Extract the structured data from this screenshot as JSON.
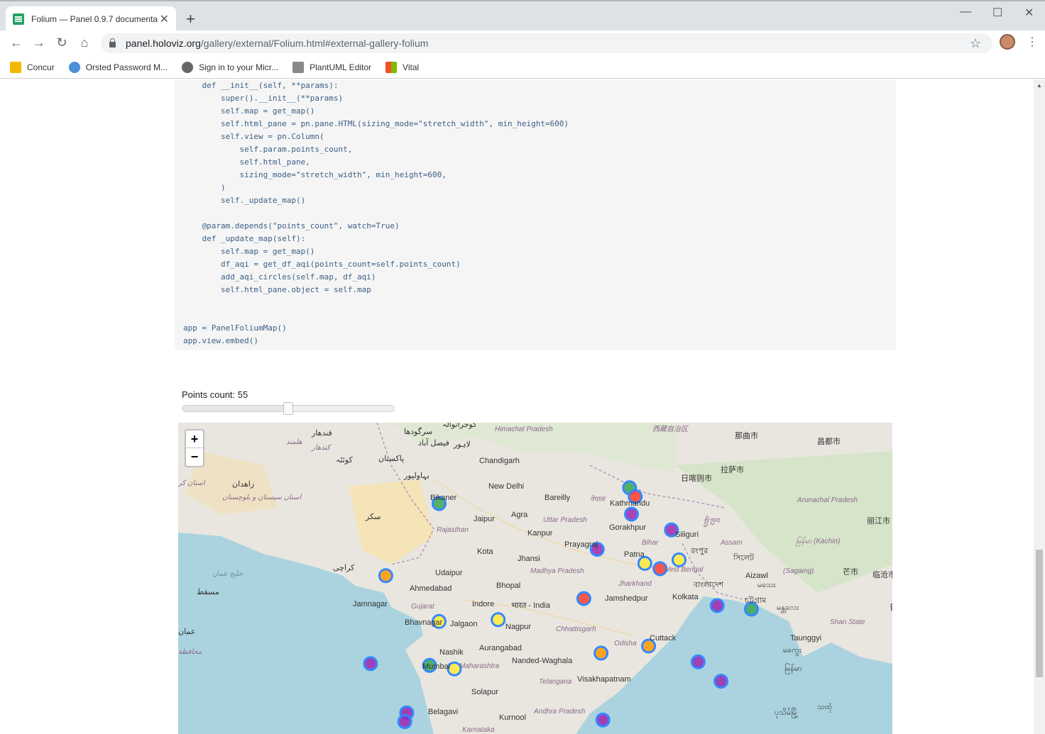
{
  "browser": {
    "tab_title": "Folium — Panel 0.9.7 documenta",
    "url_host": "panel.holoviz.org",
    "url_path": "/gallery/external/Folium.html#external-gallery-folium",
    "bookmarks": [
      "Concur",
      "Orsted Password M...",
      "Sign in to your Micr...",
      "PlantUML Editor",
      "Vital"
    ]
  },
  "code": {
    "lines": [
      "    def __init__(self, **params):",
      "        super().__init__(**params)",
      "        self.map = get_map()",
      "        self.html_pane = pn.pane.HTML(sizing_mode=\"stretch_width\", min_height=600)",
      "        self.view = pn.Column(",
      "            self.param.points_count,",
      "            self.html_pane,",
      "            sizing_mode=\"stretch_width\", min_height=600,",
      "        )",
      "        self._update_map()",
      "",
      "    @param.depends(\"points_count\", watch=True)",
      "    def _update_map(self):",
      "        self.map = get_map()",
      "        df_aqi = get_df_aqi(points_count=self.points_count)",
      "        add_aqi_circles(self.map, df_aqi)",
      "        self.html_pane.object = self.map",
      "",
      "",
      "app = PanelFoliumMap()",
      "app.view.embed()"
    ]
  },
  "slider": {
    "label": "Points count: ",
    "value": "55",
    "fraction": 0.5
  },
  "map": {
    "zoom_in": "+",
    "zoom_out": "−",
    "labels": [
      {
        "text": "قندهار"
      },
      {
        "text": "سرگودھا"
      },
      {
        "text": "گوجرانوالہ"
      },
      {
        "text": "Himachal Pradesh",
        "kind": "region"
      },
      {
        "text": "西藏自治区",
        "kind": "region"
      },
      {
        "text": "那曲市"
      },
      {
        "text": "昌都市"
      },
      {
        "text": "هلمند",
        "kind": "region"
      },
      {
        "text": "کندهار",
        "kind": "region"
      },
      {
        "text": "فیصل آباد"
      },
      {
        "text": "لاہور"
      },
      {
        "text": "کوئٹہ"
      },
      {
        "text": "پاکستان"
      },
      {
        "text": "Chandigarh"
      },
      {
        "text": "日喀则市"
      },
      {
        "text": "拉萨市"
      },
      {
        "text": "استان کر",
        "kind": "region"
      },
      {
        "text": "زاهدان"
      },
      {
        "text": "بہاولپور"
      },
      {
        "text": "New Delhi"
      },
      {
        "text": "नेपाल",
        "kind": "region"
      },
      {
        "text": "Bareilly"
      },
      {
        "text": "Bikaner"
      },
      {
        "text": "استان سیستان و بلوچستان",
        "kind": "region"
      },
      {
        "text": "Kathmandu"
      },
      {
        "text": "Arunachal Pradesh",
        "kind": "region"
      },
      {
        "text": "སྤྱི་ཁྱབ",
        "kind": "region"
      },
      {
        "text": "Agra"
      },
      {
        "text": "Jaipur"
      },
      {
        "text": "سکر"
      },
      {
        "text": "Uttar Pradesh",
        "kind": "region"
      },
      {
        "text": "Gorakhpur"
      },
      {
        "text": "丽江市"
      },
      {
        "text": "Rajasthan",
        "kind": "region"
      },
      {
        "text": "Kanpur"
      },
      {
        "text": "Siliguri"
      },
      {
        "text": "Prayagraj"
      },
      {
        "text": "Bihar",
        "kind": "region"
      },
      {
        "text": "Assam",
        "kind": "region"
      },
      {
        "text": "Kota"
      },
      {
        "text": "রংপুর"
      },
      {
        "text": "မြန်မာ (Kachin)",
        "kind": "region"
      },
      {
        "text": "Patna"
      },
      {
        "text": "সিলেট"
      },
      {
        "text": "Jhansi"
      },
      {
        "text": "کراچی"
      },
      {
        "text": "Udaipur"
      },
      {
        "text": "West Bengal",
        "kind": "region"
      },
      {
        "text": "(Sagaing)",
        "kind": "region"
      },
      {
        "text": "芒市"
      },
      {
        "text": "临沧市"
      },
      {
        "text": "Madhya Pradesh",
        "kind": "region"
      },
      {
        "text": "Aizawl"
      },
      {
        "text": "خليج عمان",
        "kind": "sea"
      },
      {
        "text": "Jharkhand",
        "kind": "region"
      },
      {
        "text": "မသေး"
      },
      {
        "text": "مسقط"
      },
      {
        "text": "Ahmedabad"
      },
      {
        "text": "Bhopal"
      },
      {
        "text": "বাংলাদেশ"
      },
      {
        "text": "Jamshedpur"
      },
      {
        "text": "Kolkata"
      },
      {
        "text": "চট্টগ্রাম"
      },
      {
        "text": "Jamnagar"
      },
      {
        "text": "Gujarat",
        "kind": "region"
      },
      {
        "text": "Indore"
      },
      {
        "text": "भारत - India"
      },
      {
        "text": "မန္တလေး"
      },
      {
        "text": "Shan State",
        "kind": "region"
      },
      {
        "text": "普洱"
      },
      {
        "text": "Bhavnagar"
      },
      {
        "text": "Jalgaon"
      },
      {
        "text": "Nagpur"
      },
      {
        "text": "عمان"
      },
      {
        "text": "Chhattisgarh",
        "kind": "region"
      },
      {
        "text": "محافظة",
        "kind": "region"
      },
      {
        "text": "Cuttack"
      },
      {
        "text": "Odisha",
        "kind": "region"
      },
      {
        "text": "Aurangabad"
      },
      {
        "text": "Nashik"
      },
      {
        "text": "Taunggyi"
      },
      {
        "text": "မကွေး"
      },
      {
        "text": "Nanded-Waghala"
      },
      {
        "text": "Mumbai"
      },
      {
        "text": "Maharashtra",
        "kind": "region"
      },
      {
        "text": "မြန်မာ"
      },
      {
        "text": "Telangana",
        "kind": "region"
      },
      {
        "text": "Visakhapatnam"
      },
      {
        "text": "Solapur"
      },
      {
        "text": "Belagavi"
      },
      {
        "text": "Andhra Pradesh",
        "kind": "region"
      },
      {
        "text": "Kurnool"
      },
      {
        "text": "Karnataka",
        "kind": "region"
      },
      {
        "text": "ပုသိမ်မြို့"
      },
      {
        "text": "သထုံ"
      }
    ],
    "points": [
      {
        "lat": 29.0,
        "lon": 83.3,
        "color": "#3aa655"
      },
      {
        "lat": 28.5,
        "lon": 83.6,
        "color": "#ff3b30"
      },
      {
        "lat": 27.5,
        "lon": 83.4,
        "color": "#9c27b0"
      },
      {
        "lat": 28.1,
        "lon": 73.3,
        "color": "#3aa655"
      },
      {
        "lat": 26.6,
        "lon": 85.5,
        "color": "#9c27b0"
      },
      {
        "lat": 25.5,
        "lon": 81.6,
        "color": "#9c27b0"
      },
      {
        "lat": 24.9,
        "lon": 85.9,
        "color": "#ffeb3b"
      },
      {
        "lat": 24.7,
        "lon": 84.1,
        "color": "#ffeb3b"
      },
      {
        "lat": 24.4,
        "lon": 84.9,
        "color": "#ff3b30"
      },
      {
        "lat": 24.0,
        "lon": 70.5,
        "color": "#ff9800"
      },
      {
        "lat": 22.7,
        "lon": 80.9,
        "color": "#ff3b30"
      },
      {
        "lat": 22.3,
        "lon": 87.9,
        "color": "#9c27b0"
      },
      {
        "lat": 22.1,
        "lon": 89.7,
        "color": "#3aa655"
      },
      {
        "lat": 21.4,
        "lon": 73.3,
        "color": "#ffeb3b"
      },
      {
        "lat": 21.5,
        "lon": 76.4,
        "color": "#ffeb3b"
      },
      {
        "lat": 20.0,
        "lon": 84.3,
        "color": "#ff9800"
      },
      {
        "lat": 19.6,
        "lon": 81.8,
        "color": "#ff9800"
      },
      {
        "lat": 19.1,
        "lon": 86.9,
        "color": "#9c27b0"
      },
      {
        "lat": 19.0,
        "lon": 69.7,
        "color": "#9c27b0"
      },
      {
        "lat": 18.9,
        "lon": 72.8,
        "color": "#3aa655"
      },
      {
        "lat": 18.7,
        "lon": 74.1,
        "color": "#ffeb3b"
      },
      {
        "lat": 18.0,
        "lon": 88.1,
        "color": "#9c27b0"
      },
      {
        "lat": 16.2,
        "lon": 71.6,
        "color": "#9c27b0"
      },
      {
        "lat": 15.7,
        "lon": 71.5,
        "color": "#9c27b0"
      },
      {
        "lat": 15.8,
        "lon": 81.9,
        "color": "#9c27b0"
      }
    ]
  }
}
